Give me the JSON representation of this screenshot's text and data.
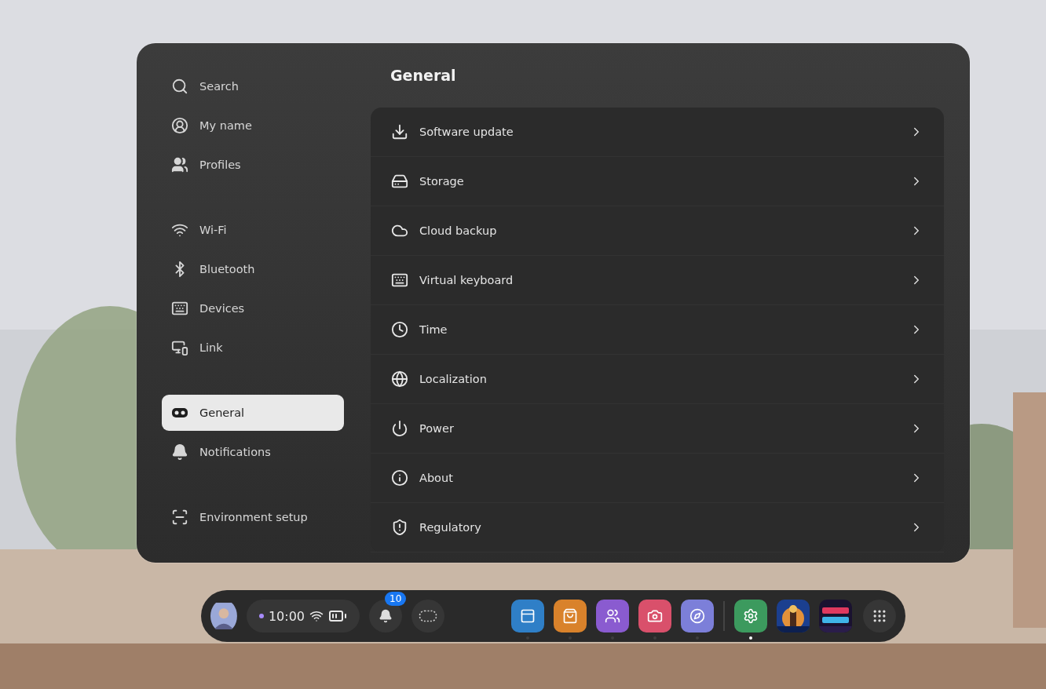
{
  "sidebar": {
    "groups": [
      {
        "items": [
          {
            "label": "Search",
            "selected": false
          },
          {
            "label": "My name",
            "selected": false
          },
          {
            "label": "Profiles",
            "selected": false
          }
        ]
      },
      {
        "items": [
          {
            "label": "Wi-Fi",
            "selected": false
          },
          {
            "label": "Bluetooth",
            "selected": false
          },
          {
            "label": "Devices",
            "selected": false
          },
          {
            "label": "Link",
            "selected": false
          }
        ]
      },
      {
        "items": [
          {
            "label": "General",
            "selected": true
          },
          {
            "label": "Notifications",
            "selected": false
          }
        ]
      },
      {
        "items": [
          {
            "label": "Environment setup",
            "selected": false
          }
        ]
      }
    ]
  },
  "content": {
    "title": "General",
    "rows": [
      {
        "label": "Software update"
      },
      {
        "label": "Storage"
      },
      {
        "label": "Cloud backup"
      },
      {
        "label": "Virtual keyboard"
      },
      {
        "label": "Time"
      },
      {
        "label": "Localization"
      },
      {
        "label": "Power"
      },
      {
        "label": "About"
      },
      {
        "label": "Regulatory"
      }
    ]
  },
  "dock": {
    "time": "10:00",
    "notification_count": "10",
    "apps": [
      {
        "kind": "app",
        "color": "#2f7fc7",
        "selected": false
      },
      {
        "kind": "app",
        "color": "#d9822b",
        "selected": false
      },
      {
        "kind": "app",
        "color": "#8a5bd0",
        "selected": false
      },
      {
        "kind": "app",
        "color": "#d9506b",
        "selected": false
      },
      {
        "kind": "app",
        "color": "#7c7fd9",
        "selected": false
      },
      {
        "kind": "divider"
      },
      {
        "kind": "app",
        "color": "#3c9a5e",
        "selected": true
      },
      {
        "kind": "picture"
      },
      {
        "kind": "picture"
      }
    ]
  }
}
